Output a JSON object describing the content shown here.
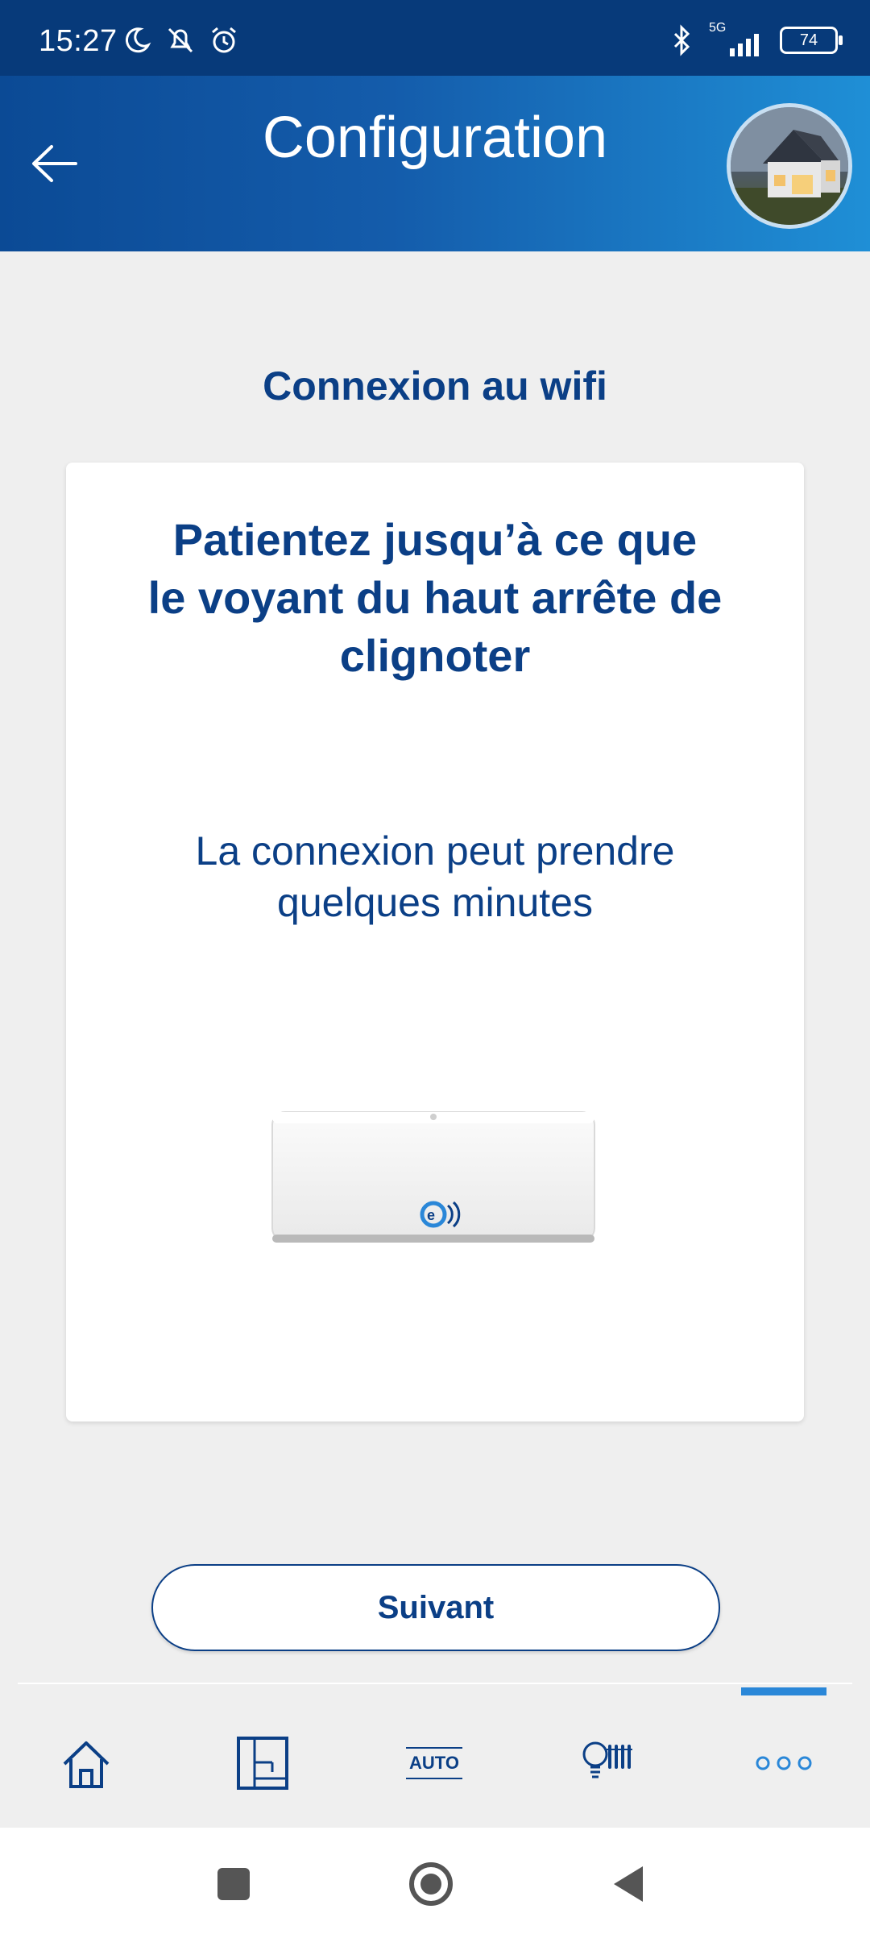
{
  "status_bar": {
    "time": "15:27",
    "network": "5G",
    "battery": "74"
  },
  "app_bar": {
    "title": "Configuration"
  },
  "main": {
    "section_title": "Connexion au wifi",
    "card": {
      "headline": "Patientez jusqu’à ce que\nle voyant du haut arrête de\nclignoter",
      "subtext": "La connexion peut prendre\nquelques minutes"
    },
    "next_button": "Suivant"
  },
  "bottom_nav": {
    "items": [
      {
        "icon": "home-icon"
      },
      {
        "icon": "floorplan-icon"
      },
      {
        "label": "AUTO",
        "icon": "auto-icon"
      },
      {
        "icon": "lighting-heating-icon"
      },
      {
        "icon": "more-icon"
      }
    ],
    "active_index": 4
  },
  "colors": {
    "primary": "#0b3f86",
    "appbar_start": "#0b4a95",
    "appbar_end": "#1f8fd6",
    "accent": "#2a87d8",
    "background": "#efefef"
  }
}
